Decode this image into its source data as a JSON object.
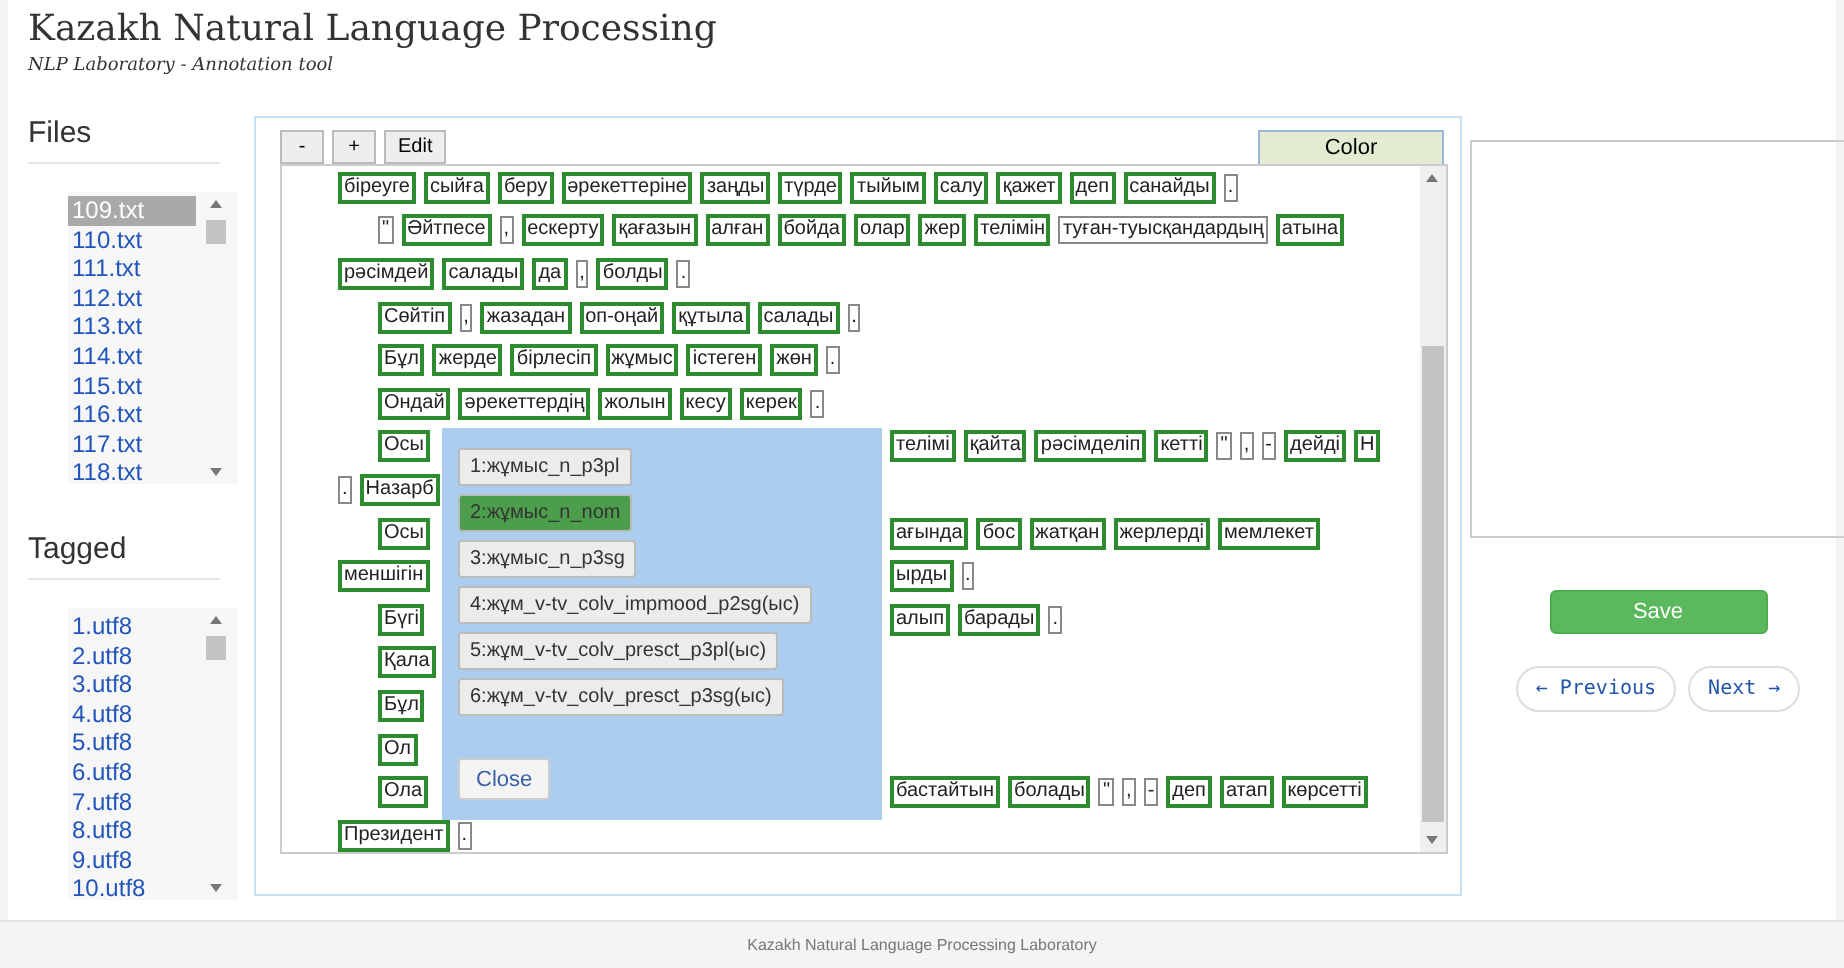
{
  "header": {
    "title": "Kazakh Natural Language Processing",
    "subtitle": "NLP Laboratory - Annotation tool"
  },
  "files": {
    "heading": "Files",
    "items": [
      {
        "label": "109.txt",
        "selected": true
      },
      {
        "label": "110.txt",
        "selected": false
      },
      {
        "label": "111.txt",
        "selected": false
      },
      {
        "label": "112.txt",
        "selected": false
      },
      {
        "label": "113.txt",
        "selected": false
      },
      {
        "label": "114.txt",
        "selected": false
      },
      {
        "label": "115.txt",
        "selected": false
      },
      {
        "label": "116.txt",
        "selected": false
      },
      {
        "label": "117.txt",
        "selected": false
      },
      {
        "label": "118.txt",
        "selected": false
      }
    ]
  },
  "tagged": {
    "heading": "Tagged",
    "items": [
      {
        "label": "1.utf8",
        "selected": false
      },
      {
        "label": "2.utf8",
        "selected": false
      },
      {
        "label": "3.utf8",
        "selected": false
      },
      {
        "label": "4.utf8",
        "selected": false
      },
      {
        "label": "5.utf8",
        "selected": false
      },
      {
        "label": "6.utf8",
        "selected": false
      },
      {
        "label": "7.utf8",
        "selected": false
      },
      {
        "label": "8.utf8",
        "selected": false
      },
      {
        "label": "9.utf8",
        "selected": false
      },
      {
        "label": "10.utf8",
        "selected": false
      }
    ]
  },
  "toolbar": {
    "buttons": [
      "-",
      "+",
      "Edit"
    ],
    "color_button": "Color"
  },
  "lines": [
    {
      "indent": false,
      "tokens": [
        {
          "text": "біреуге",
          "tagged": true
        },
        {
          "text": "сыйға",
          "tagged": true
        },
        {
          "text": "беру",
          "tagged": true
        },
        {
          "text": "әрекеттеріне",
          "tagged": true
        },
        {
          "text": "заңды",
          "tagged": true
        },
        {
          "text": "түрде",
          "tagged": true
        },
        {
          "text": "тыйым",
          "tagged": true
        },
        {
          "text": "салу",
          "tagged": true
        },
        {
          "text": "қажет",
          "tagged": true
        },
        {
          "text": "деп",
          "tagged": true
        },
        {
          "text": "санайды",
          "tagged": true
        },
        {
          "text": ".",
          "tagged": false
        }
      ]
    },
    {
      "indent": true,
      "tokens": [
        {
          "text": "\"",
          "tagged": false
        },
        {
          "text": "Әйтпесе",
          "tagged": true
        },
        {
          "text": ",",
          "tagged": false
        },
        {
          "text": "ескерту",
          "tagged": true
        },
        {
          "text": "қағазын",
          "tagged": true
        },
        {
          "text": "алған",
          "tagged": true
        },
        {
          "text": "бойда",
          "tagged": true
        },
        {
          "text": "олар",
          "tagged": true
        },
        {
          "text": "жер",
          "tagged": true
        },
        {
          "text": "телімін",
          "tagged": true
        },
        {
          "text": "туған-туысқандардың",
          "tagged": false
        },
        {
          "text": "атына",
          "tagged": true
        }
      ]
    },
    {
      "indent": false,
      "tokens": [
        {
          "text": "рәсімдей",
          "tagged": true
        },
        {
          "text": "салады",
          "tagged": true
        },
        {
          "text": "да",
          "tagged": true
        },
        {
          "text": ",",
          "tagged": false
        },
        {
          "text": "болды",
          "tagged": true
        },
        {
          "text": ".",
          "tagged": false
        }
      ]
    },
    {
      "indent": true,
      "tokens": [
        {
          "text": "Сөйтіп",
          "tagged": true
        },
        {
          "text": ",",
          "tagged": false
        },
        {
          "text": "жазадан",
          "tagged": true
        },
        {
          "text": "оп-оңай",
          "tagged": true
        },
        {
          "text": "құтыла",
          "tagged": true
        },
        {
          "text": "салады",
          "tagged": true
        },
        {
          "text": ".",
          "tagged": false
        }
      ]
    },
    {
      "indent": true,
      "tokens": [
        {
          "text": "Бұл",
          "tagged": true
        },
        {
          "text": "жерде",
          "tagged": true
        },
        {
          "text": "бірлесіп",
          "tagged": true
        },
        {
          "text": "жұмыс",
          "tagged": true
        },
        {
          "text": "істеген",
          "tagged": true
        },
        {
          "text": "жөн",
          "tagged": true
        },
        {
          "text": ".",
          "tagged": false
        }
      ]
    },
    {
      "indent": true,
      "tokens": [
        {
          "text": "Ондай",
          "tagged": true
        },
        {
          "text": "әрекеттердің",
          "tagged": true
        },
        {
          "text": "жолын",
          "tagged": true
        },
        {
          "text": "кесу",
          "tagged": true
        },
        {
          "text": "керек",
          "tagged": true
        },
        {
          "text": ".",
          "tagged": false
        }
      ]
    },
    {
      "indent": true,
      "tokens": [
        {
          "text": "Осы",
          "tagged": true
        }
      ],
      "after_dialog": [
        {
          "text": "телімі",
          "tagged": true
        },
        {
          "text": "қайта",
          "tagged": true
        },
        {
          "text": "рәсімделіп",
          "tagged": true
        },
        {
          "text": "кетті",
          "tagged": true
        },
        {
          "text": "\"",
          "tagged": false
        },
        {
          "text": ",",
          "tagged": false
        },
        {
          "text": "-",
          "tagged": false
        },
        {
          "text": "дейді",
          "tagged": true
        },
        {
          "text": "Н",
          "tagged": true
        }
      ]
    },
    {
      "indent": false,
      "tokens": [
        {
          "text": ".",
          "tagged": false
        },
        {
          "text": "Назарб",
          "tagged": true
        }
      ]
    },
    {
      "indent": true,
      "tokens": [
        {
          "text": "Осы",
          "tagged": true
        }
      ],
      "after_dialog": [
        {
          "text": "ағында",
          "tagged": true
        },
        {
          "text": "бос",
          "tagged": true
        },
        {
          "text": "жатқан",
          "tagged": true
        },
        {
          "text": "жерлерді",
          "tagged": true
        },
        {
          "text": "мемлекет",
          "tagged": true
        }
      ]
    },
    {
      "indent": false,
      "tokens": [
        {
          "text": "меншігін",
          "tagged": true
        }
      ],
      "after_dialog": [
        {
          "text": "ырды",
          "tagged": true
        },
        {
          "text": ".",
          "tagged": false
        }
      ]
    },
    {
      "indent": true,
      "tokens": [
        {
          "text": "Бүгі",
          "tagged": true
        }
      ],
      "after_dialog": [
        {
          "text": "алып",
          "tagged": true
        },
        {
          "text": "барады",
          "tagged": true
        },
        {
          "text": ".",
          "tagged": false
        }
      ]
    },
    {
      "indent": true,
      "tokens": [
        {
          "text": "Қала",
          "tagged": true
        }
      ]
    },
    {
      "indent": true,
      "tokens": [
        {
          "text": "Бұл",
          "tagged": true
        }
      ]
    },
    {
      "indent": true,
      "tokens": [
        {
          "text": "Ол",
          "tagged": true
        }
      ]
    },
    {
      "indent": true,
      "tokens": [
        {
          "text": "Ола",
          "tagged": true
        }
      ],
      "after_dialog": [
        {
          "text": "бастайтын",
          "tagged": true
        },
        {
          "text": "болады",
          "tagged": true
        },
        {
          "text": "\"",
          "tagged": false
        },
        {
          "text": ",",
          "tagged": false
        },
        {
          "text": "-",
          "tagged": false
        },
        {
          "text": "деп",
          "tagged": true
        },
        {
          "text": "атап",
          "tagged": true
        },
        {
          "text": "көрсетті",
          "tagged": true
        }
      ]
    },
    {
      "indent": false,
      "tokens": [
        {
          "text": "Президент",
          "tagged": true
        },
        {
          "text": ".",
          "tagged": false
        }
      ]
    }
  ],
  "dialog": {
    "options": [
      {
        "label": "1:жұмыс_n_p3pl",
        "selected": false
      },
      {
        "label": "2:жұмыс_n_nom",
        "selected": true
      },
      {
        "label": "3:жұмыс_n_p3sg",
        "selected": false
      },
      {
        "label": "4:жұм_v-tv_colv_impmood_p2sg(ыс)",
        "selected": false
      },
      {
        "label": "5:жұм_v-tv_colv_presct_p3pl(ыс)",
        "selected": false
      },
      {
        "label": "6:жұм_v-tv_colv_presct_p3sg(ыс)",
        "selected": false
      }
    ],
    "close": "Close"
  },
  "actions": {
    "save": "Save",
    "previous": "← Previous",
    "next": "Next →"
  },
  "footer": "Kazakh Natural Language Processing Laboratory"
}
